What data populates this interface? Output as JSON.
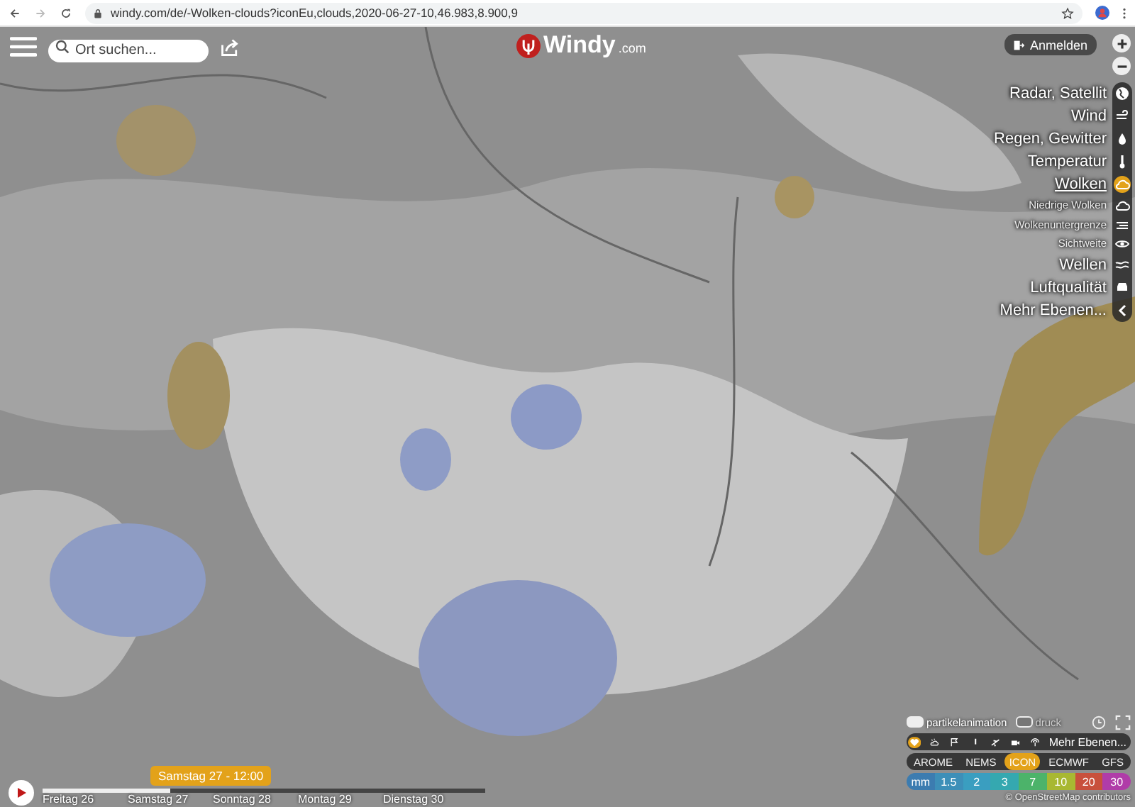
{
  "browser": {
    "url": "windy.com/de/-Wolken-clouds?iconEu,clouds,2020-06-27-10,46.983,8.900,9"
  },
  "toolbar": {
    "search_placeholder": "Ort suchen...",
    "logo": "Windy",
    "logo_suffix": ".com",
    "login": "Anmelden"
  },
  "layers": [
    {
      "label": "Radar, Satellit",
      "kind": "main",
      "selected": false
    },
    {
      "label": "Wind",
      "kind": "main",
      "selected": false
    },
    {
      "label": "Regen, Gewitter",
      "kind": "main",
      "selected": false
    },
    {
      "label": "Temperatur",
      "kind": "main",
      "selected": false
    },
    {
      "label": "Wolken",
      "kind": "main",
      "selected": true
    },
    {
      "label": "Niedrige Wolken",
      "kind": "sub",
      "selected": false
    },
    {
      "label": "Wolkenuntergrenze",
      "kind": "sub",
      "selected": false
    },
    {
      "label": "Sichtweite",
      "kind": "sub",
      "selected": false
    },
    {
      "label": "Wellen",
      "kind": "main",
      "selected": false
    },
    {
      "label": "Luftqualität",
      "kind": "main",
      "selected": false
    },
    {
      "label": "Mehr Ebenen...",
      "kind": "main",
      "selected": false
    }
  ],
  "overlay_toggles": [
    {
      "label": "partikelanimation",
      "on": true
    },
    {
      "label": "druck",
      "on": false
    }
  ],
  "quick_layers": [
    {
      "kind": "heart",
      "selected": true
    },
    {
      "kind": "cloud-sun",
      "selected": false
    },
    {
      "kind": "flag",
      "selected": false
    },
    {
      "kind": "thermometer",
      "selected": false
    },
    {
      "kind": "plane",
      "selected": false
    },
    {
      "kind": "camera",
      "selected": false
    },
    {
      "kind": "antenna",
      "selected": false
    }
  ],
  "quick_more": "Mehr Ebenen...",
  "models": [
    {
      "label": "AROME",
      "selected": false
    },
    {
      "label": "NEMS",
      "selected": false
    },
    {
      "label": "ICON",
      "selected": true
    },
    {
      "label": "ECMWF",
      "selected": false
    },
    {
      "label": "GFS",
      "selected": false
    }
  ],
  "legend": {
    "unit": "mm",
    "stops": [
      {
        "label": "1.5",
        "color": "#3d8fb8"
      },
      {
        "label": "2",
        "color": "#3a9ec0"
      },
      {
        "label": "3",
        "color": "#35a8b0"
      },
      {
        "label": "7",
        "color": "#4cb36a"
      },
      {
        "label": "10",
        "color": "#a8b832"
      },
      {
        "label": "20",
        "color": "#c8503c"
      },
      {
        "label": "30",
        "color": "#b03ca8"
      }
    ]
  },
  "attribution": "© OpenStreetMap contributors",
  "timeline": {
    "level": 0.29,
    "current": "Samstag 27 - 12:00",
    "days": [
      "Freitag 26",
      "Samstag 27",
      "Sonntag 28",
      "Montag 29",
      "Dienstag 30"
    ]
  }
}
